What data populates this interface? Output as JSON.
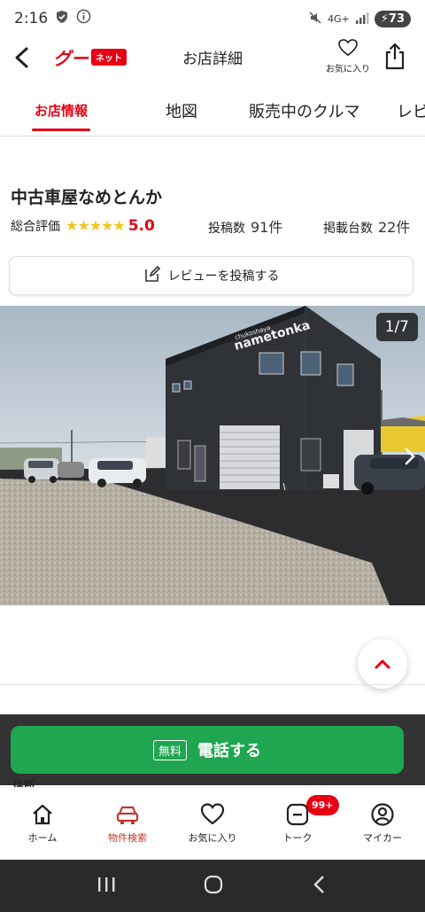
{
  "status_bar": {
    "time": "2:16",
    "network": "4G+",
    "battery": "73"
  },
  "header": {
    "logo_text": "グー",
    "logo_badge": "ネット",
    "title": "お店詳細",
    "favorite_label": "お気に入り"
  },
  "tabs": [
    {
      "label": "お店情報",
      "active": true
    },
    {
      "label": "地図",
      "active": false
    },
    {
      "label": "販売中のクルマ",
      "active": false
    },
    {
      "label": "レビ",
      "active": false
    }
  ],
  "shop": {
    "name": "中古車屋なめとんか",
    "rating_label": "総合評価",
    "stars": "★★★★★",
    "rating_value": "5.0",
    "posts_label": "投稿数",
    "posts_count": "91件",
    "listings_label": "掲載台数",
    "listings_count": "22件"
  },
  "review_button": {
    "label": "レビューを投稿する"
  },
  "gallery": {
    "counter": "1/7",
    "building_sign_small": "chukoshaya",
    "building_sign": "nametonka"
  },
  "call": {
    "badge": "無料",
    "label": "電話する"
  },
  "address_peek": "住所",
  "bottom_nav": [
    {
      "label": "ホーム",
      "icon": "home-icon"
    },
    {
      "label": "物件検索",
      "icon": "car-icon",
      "active": true
    },
    {
      "label": "お気に入り",
      "icon": "heart-icon"
    },
    {
      "label": "トーク",
      "icon": "talk-icon",
      "badge": "99+"
    },
    {
      "label": "マイカー",
      "icon": "user-icon"
    }
  ],
  "colors": {
    "accent": "#e60012",
    "call": "#1ea651",
    "star": "#f5c518"
  }
}
